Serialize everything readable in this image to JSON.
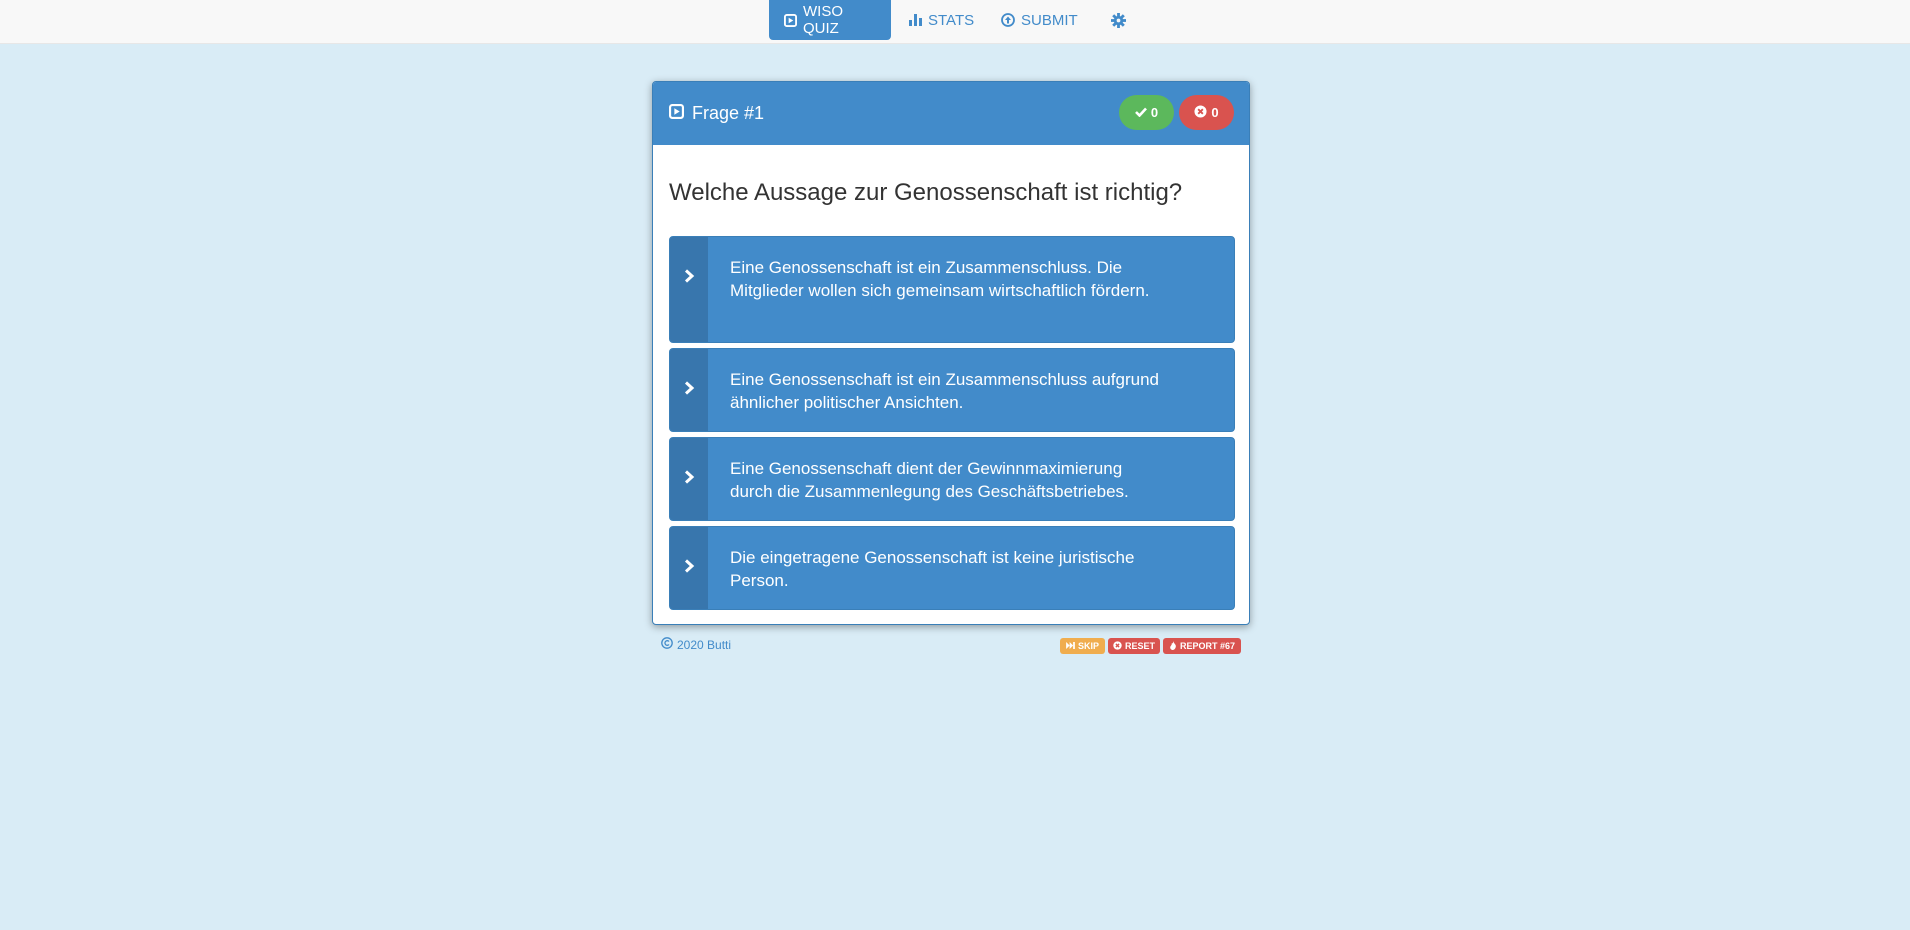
{
  "nav": {
    "items": [
      {
        "label": "WISO QUIZ",
        "icon": "play-square-icon",
        "active": true
      },
      {
        "label": "STATS",
        "icon": "bar-chart-icon",
        "active": false
      },
      {
        "label": "SUBMIT",
        "icon": "upload-circle-icon",
        "active": false
      },
      {
        "label": "",
        "icon": "gear-icon",
        "active": false
      }
    ]
  },
  "card": {
    "title": "Frage #1",
    "title_icon": "play-square-icon",
    "correct_count": "0",
    "wrong_count": "0",
    "question": "Welche Aussage zur Genossenschaft ist richtig?",
    "answers": [
      {
        "text": "Eine Genossenschaft ist ein Zusammenschluss. Die Mitglieder wollen sich gemeinsam wirtschaftlich fördern."
      },
      {
        "text": "Eine Genossenschaft ist ein Zusammenschluss aufgrund ähnlicher politischer Ansichten."
      },
      {
        "text": "Eine Genossenschaft dient der Gewinnmaximierung durch die Zusammenlegung des Geschäftsbetriebes."
      },
      {
        "text": "Die eingetragene Genossenschaft ist keine juristische Person."
      }
    ]
  },
  "footer": {
    "copyright": "2020 Butti",
    "skip": "SKIP",
    "reset": "RESET",
    "report": "REPORT #67"
  },
  "colors": {
    "primary": "#428bca",
    "success": "#5cb85c",
    "danger": "#d9534f",
    "warning": "#f0ad4e",
    "background": "#d9ecf6"
  }
}
